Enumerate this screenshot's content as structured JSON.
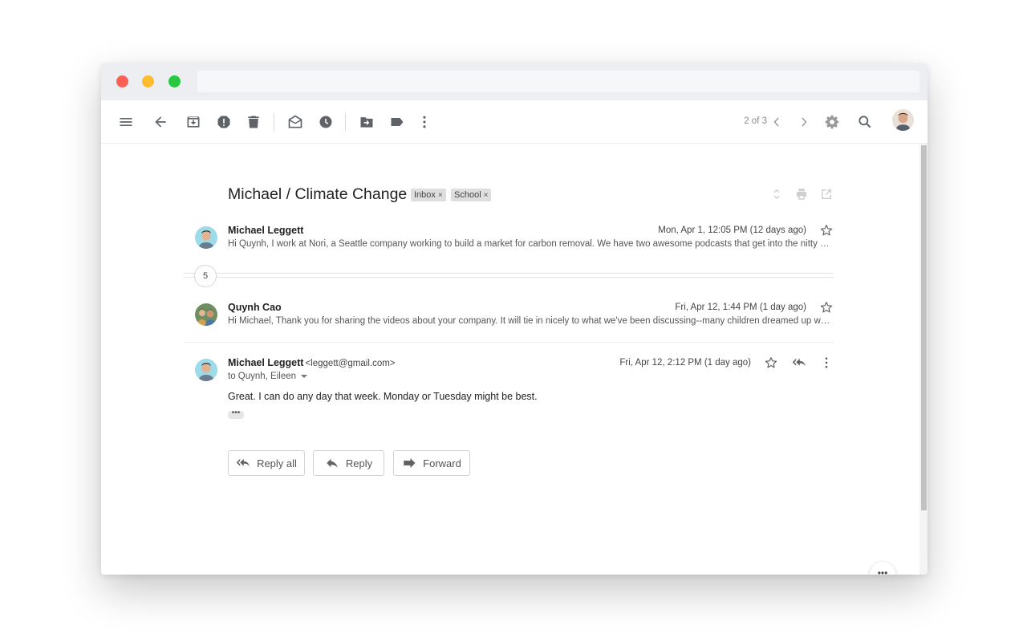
{
  "window": {
    "url": ""
  },
  "toolbar": {
    "pager_text": "2 of 3",
    "icons": [
      "menu-icon",
      "back-arrow-icon",
      "archive-icon",
      "report-spam-icon",
      "delete-icon",
      "mark-unread-icon",
      "snooze-icon",
      "move-to-icon",
      "label-icon",
      "more-vertical-icon",
      "chevron-left-icon",
      "chevron-right-icon",
      "settings-gear-icon",
      "search-icon",
      "avatar"
    ]
  },
  "thread": {
    "subject": "Michael / Climate Change",
    "labels": [
      {
        "name": "Inbox",
        "remove_glyph": "×"
      },
      {
        "name": "School",
        "remove_glyph": "×"
      }
    ],
    "collapsed_count": "5",
    "messages": [
      {
        "sender": "Michael Leggett",
        "date": "Mon, Apr 1, 12:05 PM (12 days ago)",
        "snippet": "Hi Quynh, I work at Nori, a Seattle company working to build a market for carbon removal. We have two awesome podcasts that get into the nitty gritty of how carbon removal works."
      },
      {
        "sender": "Quynh Cao",
        "date": "Fri, Apr 12, 1:44 PM (1 day ago)",
        "snippet": "Hi Michael, Thank you for sharing the videos about your company. It will tie in nicely to what we've been discussing--many children dreamed up ways to help the planet."
      },
      {
        "sender": "Michael Leggett",
        "sender_email": "<leggett@gmail.com>",
        "date": "Fri, Apr 12, 2:12 PM (1 day ago)",
        "to": "to Quynh, Eileen",
        "body": "Great. I can do any day that week. Monday or Tuesday might be best.",
        "trimmed_glyph": "•••"
      }
    ],
    "actions": {
      "reply_all": "Reply all",
      "reply": "Reply",
      "forward": "Forward"
    }
  },
  "fab": {
    "more_glyph": "•••"
  },
  "colors": {
    "google_blue": "#4285F4",
    "google_red": "#EA4335",
    "google_yellow": "#FBBC04",
    "google_green": "#34A853",
    "icon_gray": "#5f6368"
  }
}
